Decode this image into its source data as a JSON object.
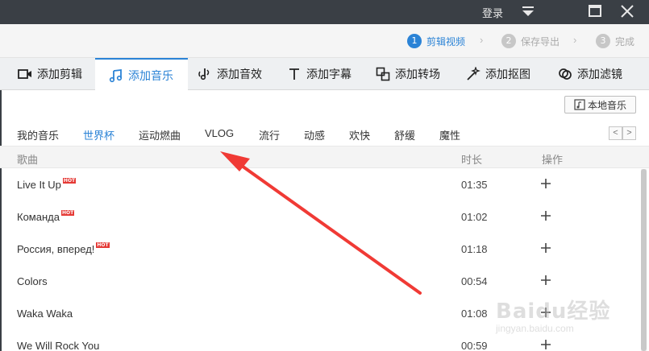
{
  "titlebar": {
    "login_label": "登录"
  },
  "steps": [
    {
      "num": "1",
      "label": "剪辑视频"
    },
    {
      "num": "2",
      "label": "保存导出"
    },
    {
      "num": "3",
      "label": "完成"
    }
  ],
  "tooltabs": [
    {
      "label": "添加剪辑",
      "icon": "video-camera-icon"
    },
    {
      "label": "添加音乐",
      "icon": "music-note-icon"
    },
    {
      "label": "添加音效",
      "icon": "sound-effect-icon"
    },
    {
      "label": "添加字幕",
      "icon": "text-t-icon"
    },
    {
      "label": "添加转场",
      "icon": "transition-icon"
    },
    {
      "label": "添加抠图",
      "icon": "magic-wand-icon"
    },
    {
      "label": "添加滤镜",
      "icon": "filter-icon"
    }
  ],
  "local_music_label": "本地音乐",
  "categories": [
    "我的音乐",
    "世界杯",
    "运动燃曲",
    "VLOG",
    "流行",
    "动感",
    "欢快",
    "舒缓",
    "魔性"
  ],
  "active_category": "世界杯",
  "pager": {
    "prev": "<",
    "next": ">"
  },
  "table": {
    "headers": {
      "song": "歌曲",
      "duration": "时长",
      "action": "操作"
    },
    "rows": [
      {
        "name": "Live It Up",
        "hot": "HOT",
        "duration": "01:35"
      },
      {
        "name": "Команда",
        "hot": "HOT",
        "duration": "01:02"
      },
      {
        "name": "Россия, вперед!",
        "hot": "HOT",
        "duration": "01:18"
      },
      {
        "name": "Colors",
        "hot": "",
        "duration": "00:54"
      },
      {
        "name": "Waka Waka",
        "hot": "",
        "duration": "01:08"
      },
      {
        "name": "We Will Rock You",
        "hot": "",
        "duration": "00:59"
      }
    ]
  },
  "watermark": {
    "logo": "Baidu经验",
    "url": "jingyan.baidu.com"
  },
  "colors": {
    "accent": "#2b83d6",
    "titlebar": "#3a3f45",
    "hot": "#e53935",
    "arrow": "#f03a35"
  }
}
